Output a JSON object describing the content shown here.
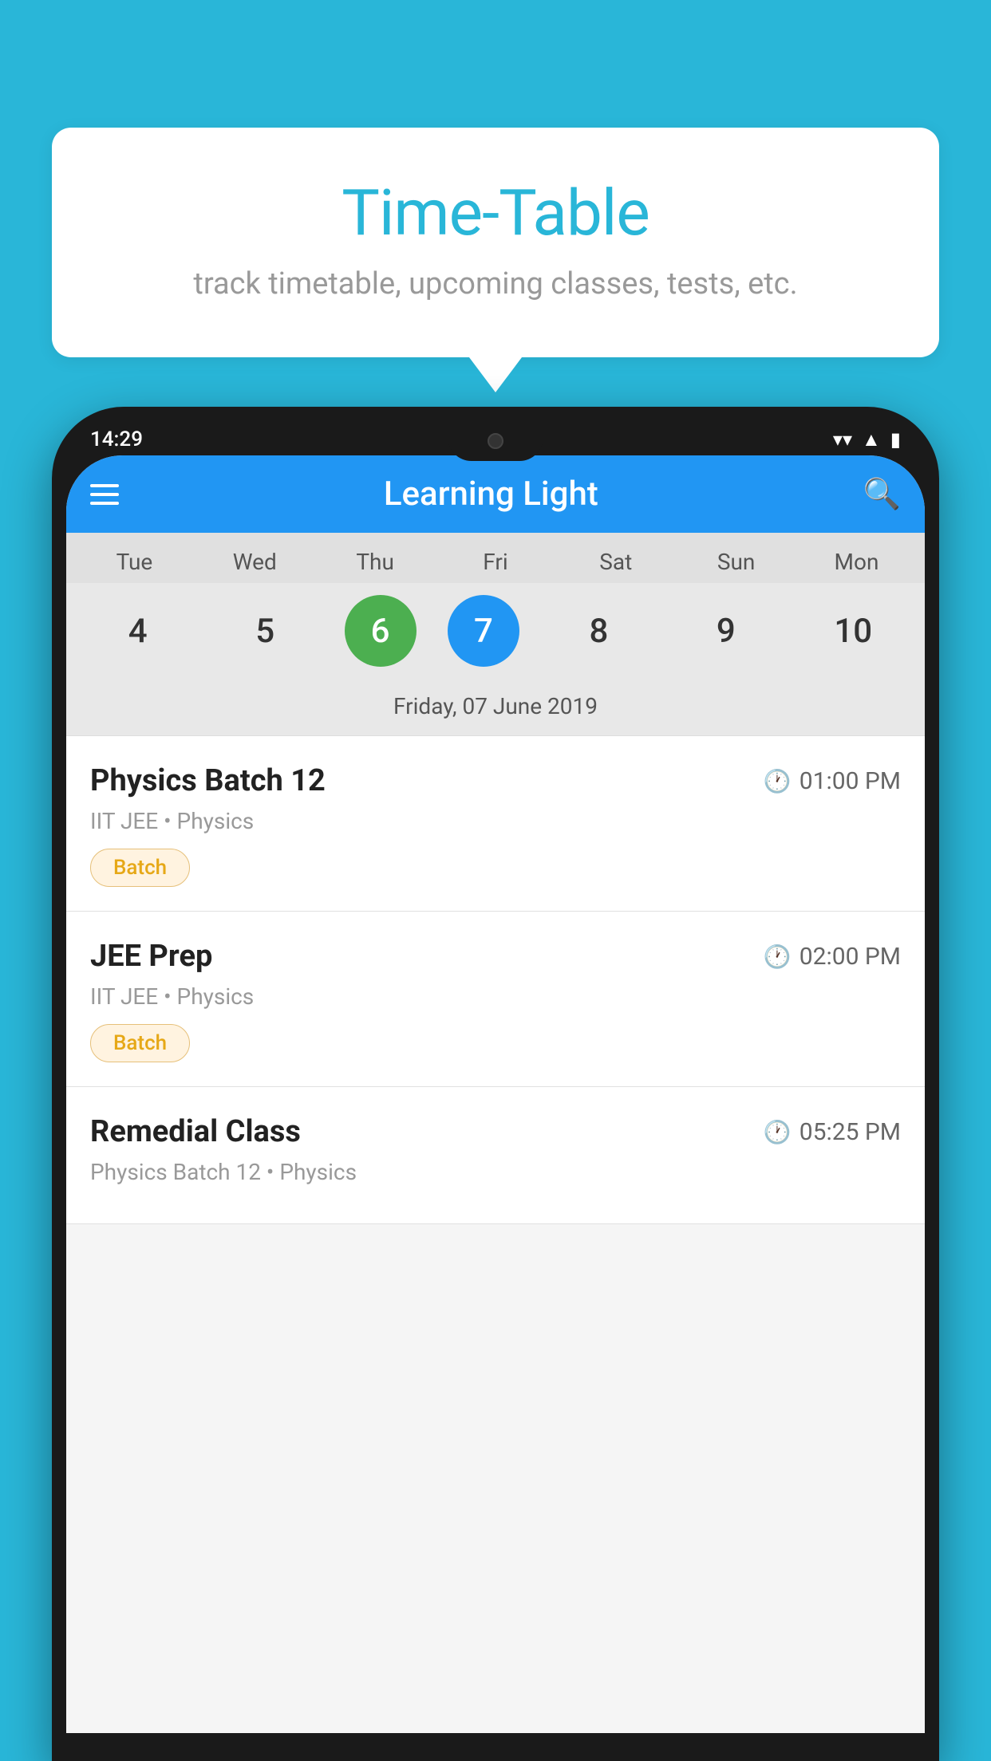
{
  "background_color": "#29b6d8",
  "bubble": {
    "title": "Time-Table",
    "subtitle": "track timetable, upcoming classes, tests, etc."
  },
  "phone": {
    "status_bar": {
      "time": "14:29"
    },
    "app_header": {
      "title": "Learning Light"
    },
    "calendar": {
      "days": [
        "Tue",
        "Wed",
        "Thu",
        "Fri",
        "Sat",
        "Sun",
        "Mon"
      ],
      "dates": [
        4,
        5,
        6,
        7,
        8,
        9,
        10
      ],
      "today_index": 2,
      "selected_index": 3,
      "selected_date_label": "Friday, 07 June 2019"
    },
    "classes": [
      {
        "name": "Physics Batch 12",
        "time": "01:00 PM",
        "meta": "IIT JEE • Physics",
        "tag": "Batch"
      },
      {
        "name": "JEE Prep",
        "time": "02:00 PM",
        "meta": "IIT JEE • Physics",
        "tag": "Batch"
      },
      {
        "name": "Remedial Class",
        "time": "05:25 PM",
        "meta": "Physics Batch 12 • Physics",
        "tag": ""
      }
    ]
  }
}
